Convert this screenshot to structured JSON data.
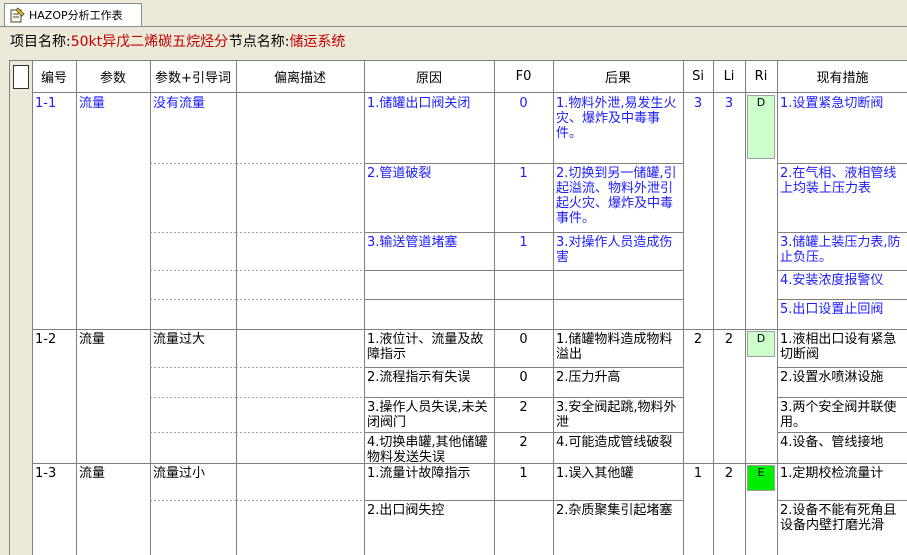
{
  "tab": {
    "title": "HAZOP分析工作表",
    "icon": "worksheet-icon"
  },
  "info": {
    "project_label": "项目名称:",
    "project_value": "50kt异戊二烯碳五烷烃分离",
    "node_label": "节点名称:",
    "node_value": "储运系统"
  },
  "headers": [
    "编号",
    "参数",
    "参数+引导词",
    "偏离描述",
    "原因",
    "F0",
    "后果",
    "Si",
    "Li",
    "Ri",
    "现有措施"
  ],
  "colors": {
    "blue_text": "#1c1cff",
    "ri_light": "#ccffcc",
    "ri_bright": "#00ee00",
    "project_value": "#c00000"
  },
  "groups": [
    {
      "id": "1-1",
      "param": "流量",
      "guide": "没有流量",
      "si": "3",
      "li": "3",
      "ri": "D"
    },
    {
      "id": "1-2",
      "param": "流量",
      "guide": "流量过大",
      "si": "2",
      "li": "2",
      "ri": "D"
    },
    {
      "id": "1-3",
      "param": "流量",
      "guide": "流量过小",
      "si": "1",
      "li": "2",
      "ri": "E"
    }
  ],
  "rows": [
    {
      "cause": "1.储罐出口阀关闭",
      "f0": "0",
      "consequence": "1.物料外泄,易发生火灾、爆炸及中毒事件。",
      "measure": "1.设置紧急切断阀"
    },
    {
      "cause": "2.管道破裂",
      "f0": "1",
      "consequence": "2.切换到另一储罐,引起溢流、物料外泄引起火灾、爆炸及中毒事件。",
      "measure": "2.在气相、液相管线上均装上压力表"
    },
    {
      "cause": "3.输送管道堵塞",
      "f0": "1",
      "consequence": "3.对操作人员造成伤害",
      "measure": "3.储罐上装压力表,防止负压。"
    },
    {
      "cause": "",
      "f0": "",
      "consequence": "",
      "measure": "4.安装浓度报警仪"
    },
    {
      "cause": "",
      "f0": "",
      "consequence": "",
      "measure": "5.出口设置止回阀"
    },
    {
      "cause": "1.液位计、流量及故障指示",
      "f0": "0",
      "consequence": "1.储罐物料造成物料溢出",
      "measure": "1.液相出口设有紧急切断阀"
    },
    {
      "cause": "2.流程指示有失误",
      "f0": "0",
      "consequence": "2.压力升高",
      "measure": "2.设置水喷淋设施"
    },
    {
      "cause": "3.操作人员失误,未关闭阀门",
      "f0": "2",
      "consequence": "3.安全阀起跳,物料外泄",
      "measure": "3.两个安全阀并联使用。"
    },
    {
      "cause": "4.切换串罐,其他储罐物料发送失误",
      "f0": "2",
      "consequence": "4.可能造成管线破裂",
      "measure": "4.设备、管线接地"
    },
    {
      "cause": "1.流量计故障指示",
      "f0": "1",
      "consequence": "1.误入其他罐",
      "measure": "1.定期校检流量计"
    },
    {
      "cause": "2.出口阀失控",
      "f0": "",
      "consequence": "2.杂质聚集引起堵塞",
      "measure": "2.设备不能有死角且设备内壁打磨光滑"
    }
  ]
}
